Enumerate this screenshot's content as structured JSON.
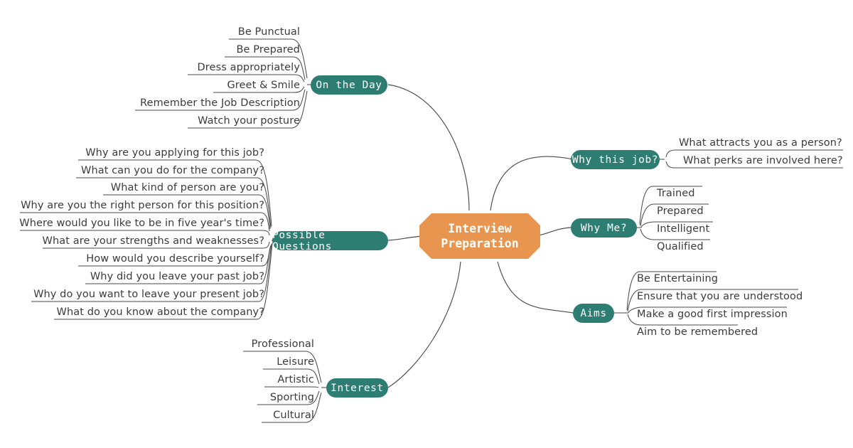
{
  "diagram": {
    "type": "mind-map",
    "title": "Interview Preparation",
    "colors": {
      "center": "#e8964f",
      "branch": "#2e7d72",
      "text": "#3b3b3b",
      "wire": "#4a4a4a",
      "background": "#ffffff"
    }
  },
  "center": {
    "line1": "Interview",
    "line2": "Preparation"
  },
  "branches": [
    {
      "id": "on-the-day",
      "label": "On the Day",
      "side": "left",
      "items": [
        "Be Punctual",
        "Be Prepared",
        "Dress appropriately",
        "Greet & Smile",
        "Remember the Job Description",
        "Watch your posture"
      ]
    },
    {
      "id": "possible-questions",
      "label": "Possible Questions",
      "side": "left",
      "items": [
        "Why are you applying for this job?",
        "What can you do for the company?",
        "What kind of person are you?",
        "Why are you the right person for this position?",
        "Where would you like to be in five year's time?",
        "What are your strengths and weaknesses?",
        "How would you describe yourself?",
        "Why did you leave your past job?",
        "Why do you want to leave your present job?",
        "What do you know about the company?"
      ]
    },
    {
      "id": "interest",
      "label": "Interest",
      "side": "left",
      "items": [
        "Professional",
        "Leisure",
        "Artistic",
        "Sporting",
        "Cultural"
      ]
    },
    {
      "id": "why-this-job",
      "label": "Why this job?",
      "side": "right",
      "items": [
        "What attracts you as a person?",
        "What perks are involved here?"
      ]
    },
    {
      "id": "why-me",
      "label": "Why Me?",
      "side": "right",
      "items": [
        "Trained",
        "Prepared",
        "Intelligent",
        "Qualified"
      ]
    },
    {
      "id": "aims",
      "label": "Aims",
      "side": "right",
      "items": [
        "Be Entertaining",
        "Ensure that you are understood",
        "Make a good first impression",
        "Aim to be remembered"
      ]
    }
  ]
}
